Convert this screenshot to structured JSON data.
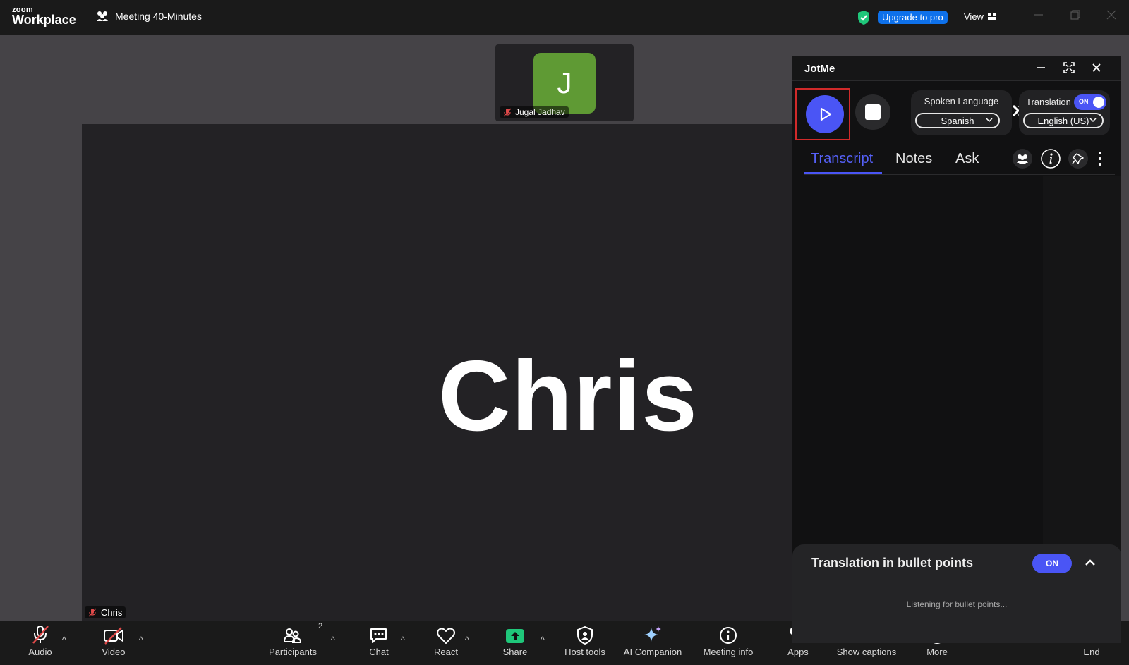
{
  "app": {
    "logo_small": "zoom",
    "logo_big": "Workplace",
    "meeting_title": "Meeting 40-Minutes",
    "upgrade_label": "Upgrade to pro",
    "view_label": "View"
  },
  "participant_thumb": {
    "initial": "J",
    "name": "Jugal Jadhav",
    "avatar_color": "#5f9a34"
  },
  "main_video": {
    "display_name": "Chris",
    "label": "Chris"
  },
  "toolbar": {
    "audio": "Audio",
    "video": "Video",
    "participants": "Participants",
    "participants_count": "2",
    "chat": "Chat",
    "react": "React",
    "share": "Share",
    "host_tools": "Host tools",
    "ai_companion": "AI Companion",
    "meeting_info": "Meeting info",
    "apps": "Apps",
    "show_captions": "Show captions",
    "more": "More",
    "end": "End"
  },
  "jotme": {
    "title": "JotMe",
    "spoken_language_label": "Spoken Language",
    "spoken_language_value": "Spanish",
    "translation_label": "Translation",
    "translation_toggle": "ON",
    "target_language_value": "English (US)",
    "tabs": [
      {
        "label": "Transcript",
        "active": true
      },
      {
        "label": "Notes",
        "active": false
      },
      {
        "label": "Ask",
        "active": false
      }
    ],
    "bullets_title": "Translation in bullet points",
    "bullets_toggle": "ON",
    "bullets_status": "Listening for bullet points..."
  },
  "colors": {
    "accent": "#4a55f5",
    "zoom_blue": "#0e71eb",
    "muted_red": "#e04a4a",
    "share_green": "#1fc77a"
  }
}
